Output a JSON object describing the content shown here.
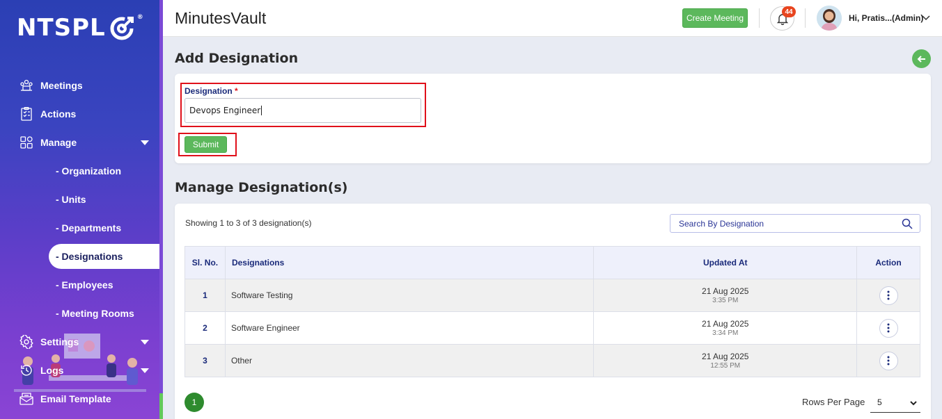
{
  "brand": {
    "logo_text": "NTSPL",
    "registered": "®"
  },
  "sidebar": {
    "items": [
      {
        "label": "Meetings"
      },
      {
        "label": "Actions"
      },
      {
        "label": "Manage"
      },
      {
        "label": "Settings"
      },
      {
        "label": "Logs"
      },
      {
        "label": "Email Template"
      }
    ],
    "manage_sub": [
      {
        "label": "- Organization"
      },
      {
        "label": "- Units"
      },
      {
        "label": "- Departments"
      },
      {
        "label": "- Designations"
      },
      {
        "label": "- Employees"
      },
      {
        "label": "- Meeting Rooms"
      }
    ]
  },
  "header": {
    "app_title": "MinutesVault",
    "create_meeting_label": "Create Meeting",
    "notification_count": "44",
    "user_greeting": "Hi, Pratis...(Admin)"
  },
  "add_form": {
    "title": "Add Designation",
    "field_label": "Designation",
    "required_mark": "*",
    "field_value": "Devops Engineer",
    "submit_label": "Submit"
  },
  "manage": {
    "title": "Manage Designation(s)",
    "showing_text": "Showing 1 to 3 of 3 designation(s)",
    "search_placeholder": "Search By Designation",
    "columns": {
      "sl": "Sl. No.",
      "name": "Designations",
      "updated": "Updated At",
      "action": "Action"
    },
    "rows": [
      {
        "sl": "1",
        "name": "Software Testing",
        "date": "21 Aug 2025",
        "time": "3:35 PM"
      },
      {
        "sl": "2",
        "name": "Software Engineer",
        "date": "21 Aug 2025",
        "time": "3:34 PM"
      },
      {
        "sl": "3",
        "name": "Other",
        "date": "21 Aug 2025",
        "time": "12:55 PM"
      }
    ],
    "current_page": "1",
    "rows_per_page_label": "Rows Per Page",
    "rows_per_page_value": "5"
  },
  "colors": {
    "accent_green": "#5cb85c",
    "highlight_red": "#e0101a",
    "sidebar_blue": "#2b3fb4"
  }
}
